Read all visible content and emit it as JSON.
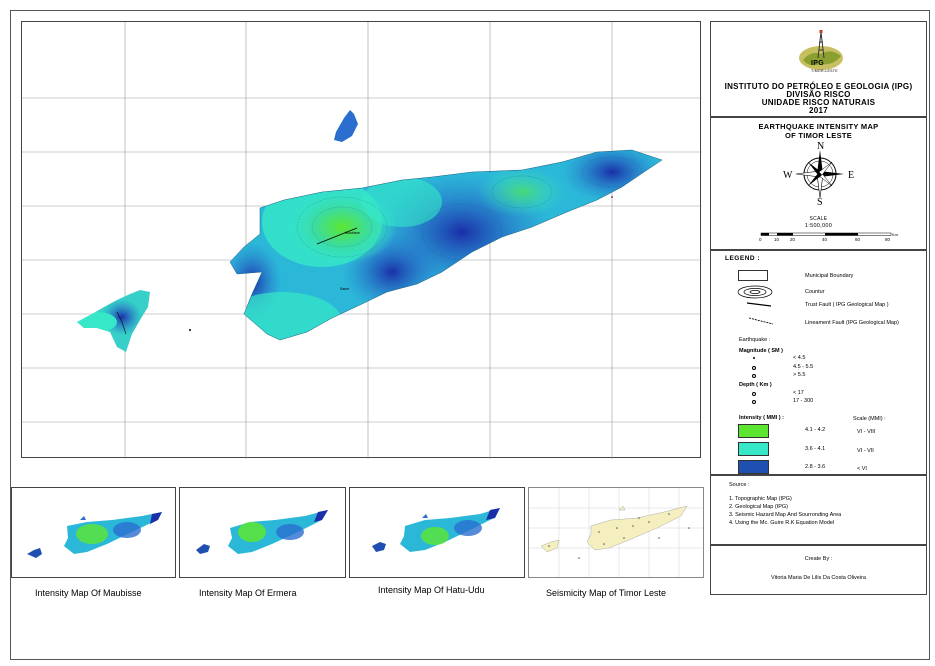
{
  "title_block": {
    "logo_text": "IPG",
    "logo_subtext": "TIMOR-LESTE",
    "institute": "INSTITUTO DO PETRÓLEO E GEOLOGIA (IPG)",
    "division": "DIVISÃO RISCO",
    "unit": "UNIDADE RISCO NATURAIS",
    "year": "2017"
  },
  "map_title": {
    "line1": "EARTHQUAKE INTENSITY MAP",
    "line2": "OF TIMOR LESTE"
  },
  "compass": {
    "n": "N",
    "s": "S",
    "e": "E",
    "w": "W"
  },
  "scale": {
    "label": "SCALE",
    "ratio": "1:500,000",
    "ticks": [
      "0",
      "10",
      "20",
      "40",
      "60",
      "80"
    ],
    "unit": "Km"
  },
  "legend": {
    "heading": "LEGEND :",
    "municipal": "Municipal Boundary",
    "contour": "Countur",
    "trust_fault": "Trust Fault ( IPG Geological Map )",
    "lineament_fault": "Lineament Fault (IPG Geological Map)",
    "earthquake": "Earthquake :",
    "magnitude": "Magnitude ( SM )",
    "mag1": "< 4.5",
    "mag2": "4.5 - 5.5",
    "mag3": "> 5.5",
    "depth": "Depth ( Km )",
    "depth1": "< 17",
    "depth2": "17 - 300",
    "intensity": "Intensity ( MMI ) :",
    "scale_mmi": "Scale (MMI) :",
    "classes": [
      {
        "range": "4.1 - 4.2",
        "scale": "VI - VIII",
        "color": "#5ce632"
      },
      {
        "range": "3.6 - 4.1",
        "scale": "VI - VII",
        "color": "#36e8c8"
      },
      {
        "range": "2.8 - 3.6",
        "scale": "< VI",
        "color": "#1f4fb0"
      }
    ]
  },
  "source": {
    "heading": "Source :",
    "items": [
      "1. Topographic Map (IPG)",
      "2. Geological Map (IPG)",
      "3. Seismic Hazard Map And Sourronding Area",
      "4. Using the Mc. Guire R.K Equation Model"
    ]
  },
  "credit": {
    "heading": "Create By :",
    "author": "Vitoria Maria De Lilis Da Costa Oliveira"
  },
  "main_map": {
    "place1": "Maubisse",
    "place2": "Same"
  },
  "insets": [
    {
      "caption": "Intensity Map Of Maubisse"
    },
    {
      "caption": "Intensity Map Of Ermera"
    },
    {
      "caption": "Intensity Map Of Hatu-Udu"
    },
    {
      "caption": "Seismicity Map of Timor Leste"
    }
  ]
}
